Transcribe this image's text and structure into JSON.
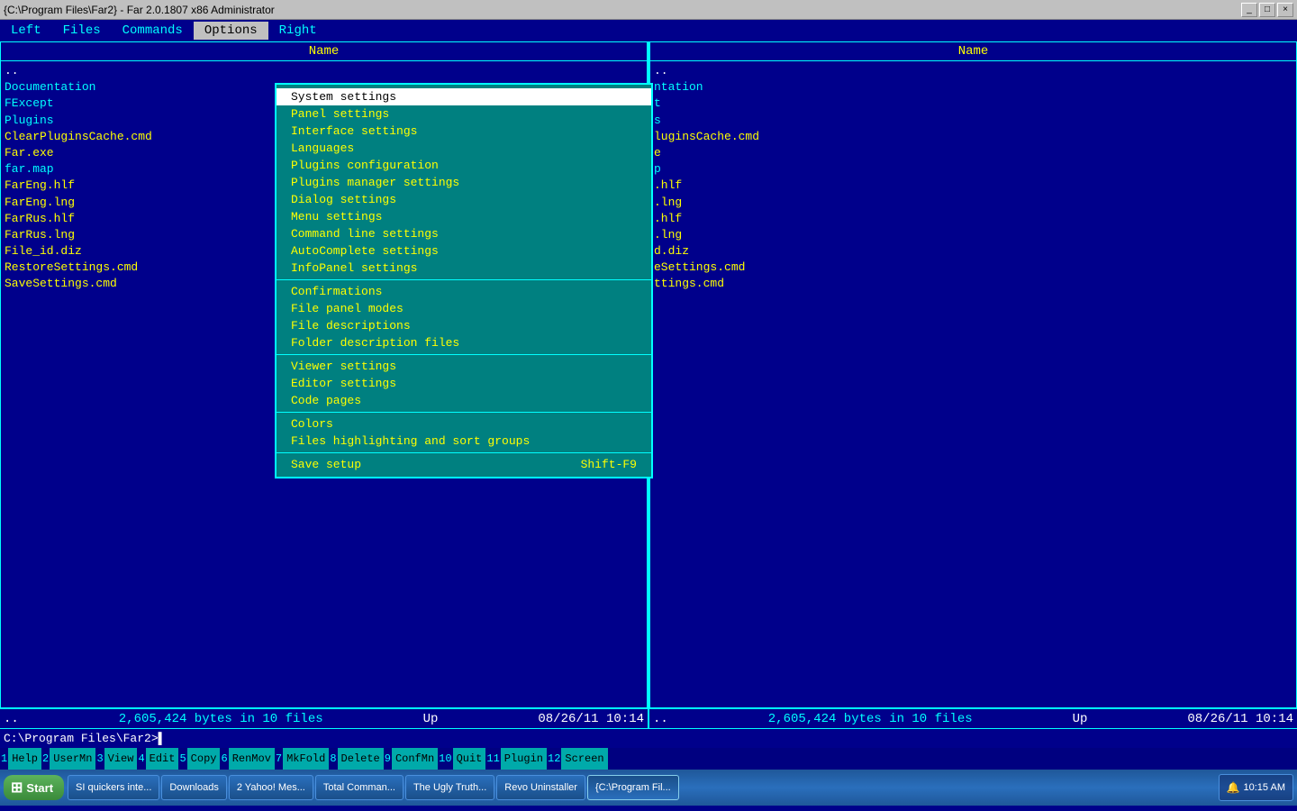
{
  "titlebar": {
    "text": "{C:\\Program Files\\Far2} - Far 2.0.1807 x86 Administrator",
    "buttons": [
      "_",
      "□",
      "×"
    ]
  },
  "menubar": {
    "items": [
      {
        "id": "left",
        "label": "Left",
        "hotkey": "L"
      },
      {
        "id": "files",
        "label": "Files",
        "hotkey": "F"
      },
      {
        "id": "commands",
        "label": "Commands",
        "hotkey": "C"
      },
      {
        "id": "options",
        "label": "Options",
        "hotkey": "O",
        "active": true
      },
      {
        "id": "right",
        "label": "Right",
        "hotkey": "R"
      }
    ]
  },
  "left_panel": {
    "header": "Name",
    "entries": [
      {
        "text": "..",
        "color": "white"
      },
      {
        "text": "Documentation",
        "color": "cyan"
      },
      {
        "text": "FExcept",
        "color": "cyan"
      },
      {
        "text": "Plugins",
        "color": "cyan"
      },
      {
        "text": "ClearPluginsCache.cmd",
        "color": "yellow"
      },
      {
        "text": "Far.exe",
        "color": "yellow"
      },
      {
        "text": "far.map",
        "color": "cyan"
      },
      {
        "text": "FarEng.hlf",
        "color": "yellow"
      },
      {
        "text": "FarEng.lng",
        "color": "yellow"
      },
      {
        "text": "FarRus.hlf",
        "color": "yellow"
      },
      {
        "text": "FarRus.lng",
        "color": "yellow"
      },
      {
        "text": "File_id.diz",
        "color": "yellow"
      },
      {
        "text": "RestoreSettings.cmd",
        "color": "yellow"
      },
      {
        "text": "SaveSettings.cmd",
        "color": "yellow"
      }
    ],
    "status": {
      "scroll": "Up",
      "date": "08/26/11 10:14",
      "bytes": "2,605,424 bytes in 10 files",
      "dots": ".."
    }
  },
  "right_panel": {
    "header": "Name",
    "entries": [
      {
        "text": "..",
        "color": "white"
      },
      {
        "text": "ntation",
        "color": "cyan"
      },
      {
        "text": "t",
        "color": "cyan"
      },
      {
        "text": "s",
        "color": "cyan"
      },
      {
        "text": "luginsCache.cmd",
        "color": "yellow"
      },
      {
        "text": "e",
        "color": "yellow"
      },
      {
        "text": "p",
        "color": "cyan"
      },
      {
        "text": ".hlf",
        "color": "yellow"
      },
      {
        "text": ".lng",
        "color": "yellow"
      },
      {
        "text": ".hlf",
        "color": "yellow"
      },
      {
        "text": ".lng",
        "color": "yellow"
      },
      {
        "text": "d.diz",
        "color": "yellow"
      },
      {
        "text": "eSettings.cmd",
        "color": "yellow"
      },
      {
        "text": "ttings.cmd",
        "color": "yellow"
      }
    ],
    "status": {
      "scroll": "Up",
      "date": "08/26/11 10:14",
      "bytes": "2,605,424 bytes in 10 files",
      "dots": ".."
    }
  },
  "options_menu": {
    "items": [
      {
        "id": "system-settings",
        "label": "System settings",
        "hotkey": "S",
        "highlighted": true
      },
      {
        "id": "panel-settings",
        "label": "Panel settings",
        "hotkey": "P"
      },
      {
        "id": "interface-settings",
        "label": "Interface settings",
        "hotkey": "I"
      },
      {
        "id": "languages",
        "label": "Languages",
        "hotkey": "L"
      },
      {
        "id": "plugins-configuration",
        "label": "Plugins configuration",
        "hotkey": "P"
      },
      {
        "id": "plugins-manager-settings",
        "label": "Plugins manager settings",
        "hotkey": "m"
      },
      {
        "id": "dialog-settings",
        "label": "Dialog settings",
        "hotkey": "D"
      },
      {
        "id": "menu-settings",
        "label": "Menu settings",
        "hotkey": "M"
      },
      {
        "id": "command-line-settings",
        "label": "Command line settings",
        "hotkey": "C"
      },
      {
        "id": "autocomplete-settings",
        "label": "AutoComplete settings",
        "hotkey": "A"
      },
      {
        "id": "infopanel-settings",
        "label": "InfoPanel settings",
        "hotkey": "n"
      },
      {
        "divider": true
      },
      {
        "id": "confirmations",
        "label": "Confirmations",
        "hotkey": "C"
      },
      {
        "id": "file-panel-modes",
        "label": "File panel modes",
        "hotkey": "F"
      },
      {
        "id": "file-descriptions",
        "label": "File descriptions",
        "hotkey": "d"
      },
      {
        "id": "folder-description-files",
        "label": "Folder description files",
        "hotkey": "F"
      },
      {
        "divider": true
      },
      {
        "id": "viewer-settings",
        "label": "Viewer settings",
        "hotkey": "V"
      },
      {
        "id": "editor-settings",
        "label": "Editor settings",
        "hotkey": "E"
      },
      {
        "id": "code-pages",
        "label": "Code pages",
        "hotkey": "C"
      },
      {
        "divider": true
      },
      {
        "id": "colors",
        "label": "Colors",
        "hotkey": "o"
      },
      {
        "id": "files-highlighting",
        "label": "Files highlighting and sort groups",
        "hotkey": "h"
      },
      {
        "divider": true
      },
      {
        "id": "save-setup",
        "label": "Save setup",
        "shortcut": "Shift-F9",
        "hotkey": "S"
      }
    ]
  },
  "cmdline": {
    "prompt": "C:\\Program Files\\Far2>",
    "cursor": ""
  },
  "fnkeys": [
    {
      "num": "1",
      "label": "Help"
    },
    {
      "num": "2",
      "label": "UserMn"
    },
    {
      "num": "3",
      "label": "View"
    },
    {
      "num": "4",
      "label": "Edit"
    },
    {
      "num": "5",
      "label": "Copy"
    },
    {
      "num": "6",
      "label": "RenMov"
    },
    {
      "num": "7",
      "label": "MkFold"
    },
    {
      "num": "8",
      "label": "Delete"
    },
    {
      "num": "9",
      "label": "ConfMn"
    },
    {
      "num": "10",
      "label": "Quit"
    },
    {
      "num": "11",
      "label": "Plugin"
    },
    {
      "num": "12",
      "label": "Screen"
    }
  ],
  "taskbar": {
    "start_label": "Start",
    "apps": [
      {
        "id": "ie",
        "label": "SI quickers inte...",
        "active": false
      },
      {
        "id": "downloads",
        "label": "Downloads",
        "active": false
      },
      {
        "id": "yahoo-mes",
        "label": "2 Yahoo! Mes...",
        "active": false
      },
      {
        "id": "total-cmd",
        "label": "Total Comman...",
        "active": false
      },
      {
        "id": "ugly-truth",
        "label": "The Ugly Truth...",
        "active": false
      },
      {
        "id": "revo",
        "label": "Revo Uninstaller",
        "active": false
      },
      {
        "id": "far2",
        "label": "{C:\\Program Fil...",
        "active": true
      }
    ],
    "time": "10:15 AM"
  }
}
